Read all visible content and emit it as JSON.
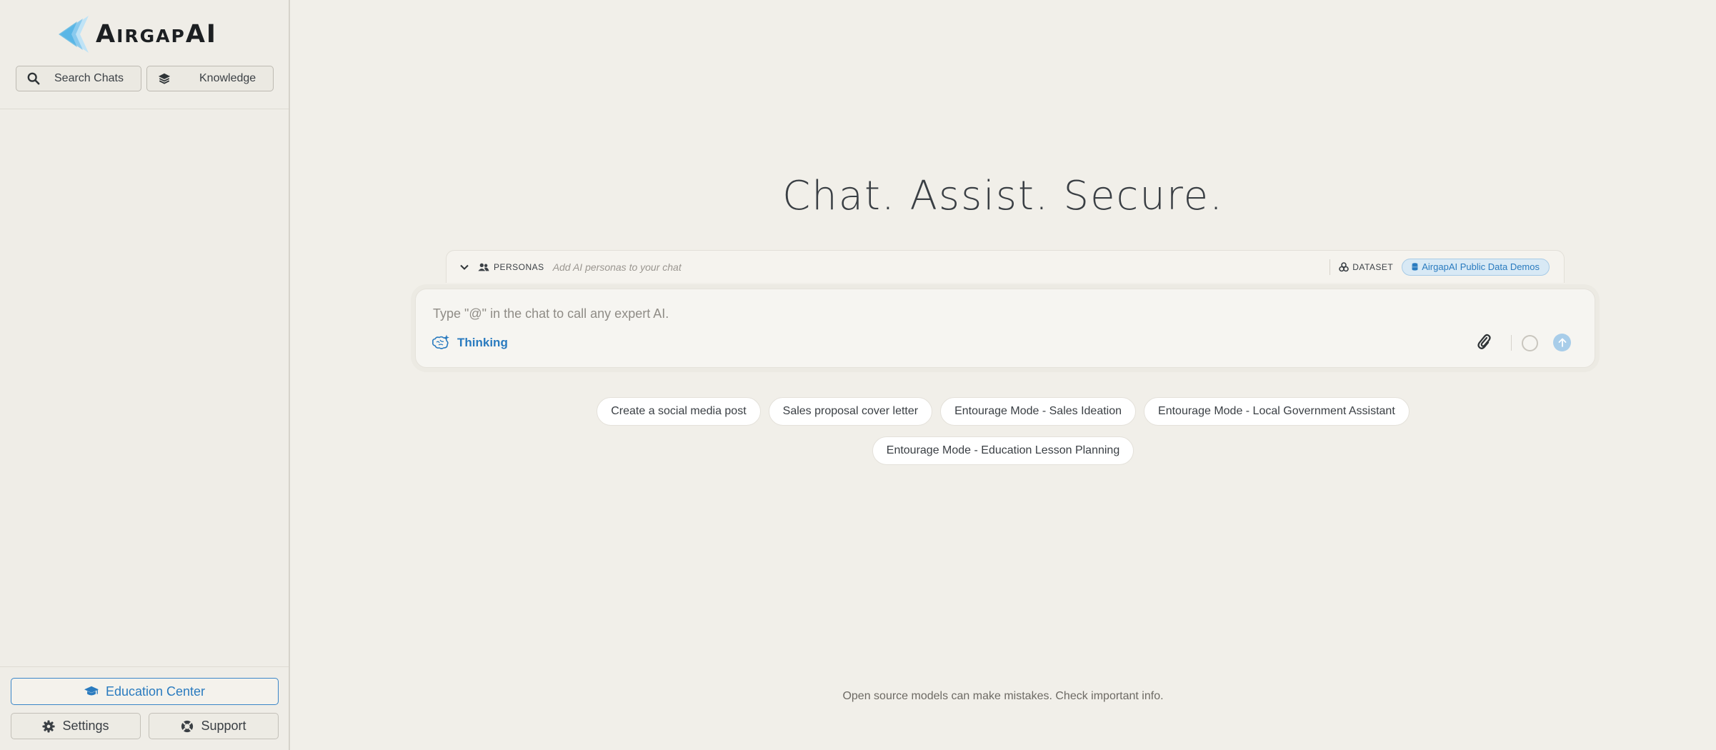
{
  "brand": {
    "name": "AirgapAI"
  },
  "sidebar": {
    "search_label": "Search Chats",
    "knowledge_label": "Knowledge",
    "education_label": "Education Center",
    "settings_label": "Settings",
    "support_label": "Support"
  },
  "main": {
    "headline": "Chat. Assist. Secure.",
    "personas": {
      "label": "PERSONAS",
      "placeholder": "Add AI personas to your chat"
    },
    "dataset": {
      "label": "DATASET",
      "selected": "AirgapAI Public Data Demos"
    },
    "composer": {
      "placeholder": "Type \"@\" in the chat to call any expert AI.",
      "thinking_label": "Thinking"
    },
    "suggestions": {
      "row1": [
        "Create a social media post",
        "Sales proposal cover letter",
        "Entourage Mode - Sales Ideation",
        "Entourage Mode - Local Government Assistant"
      ],
      "row2": [
        "Entourage Mode - Education Lesson Planning"
      ]
    },
    "footer_note": "Open source models can make mistakes. Check important info."
  },
  "colors": {
    "accent": "#2a7bbf",
    "background": "#f1efe9",
    "chip_bg": "#d8e9f5"
  }
}
